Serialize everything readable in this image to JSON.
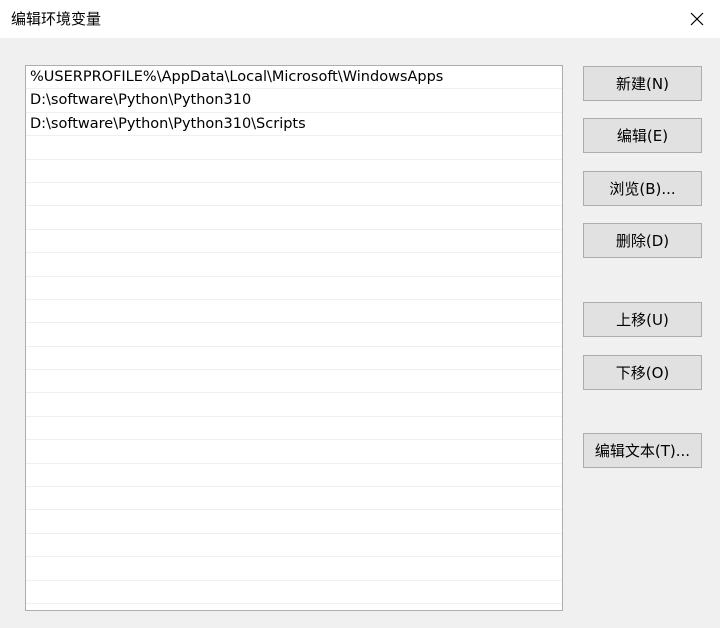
{
  "window": {
    "title": "编辑环境变量",
    "close_icon": "close-icon"
  },
  "paths": [
    "%USERPROFILE%\\AppData\\Local\\Microsoft\\WindowsApps",
    "D:\\software\\Python\\Python310",
    "D:\\software\\Python\\Python310\\Scripts",
    "",
    "",
    "",
    "",
    "",
    "",
    "",
    "",
    "",
    "",
    "",
    "",
    "",
    "",
    "",
    "",
    "",
    "",
    "",
    ""
  ],
  "buttons": {
    "new": "新建(N)",
    "edit": "编辑(E)",
    "browse": "浏览(B)...",
    "delete": "删除(D)",
    "move_up": "上移(U)",
    "move_down": "下移(O)",
    "edit_text": "编辑文本(T)..."
  }
}
